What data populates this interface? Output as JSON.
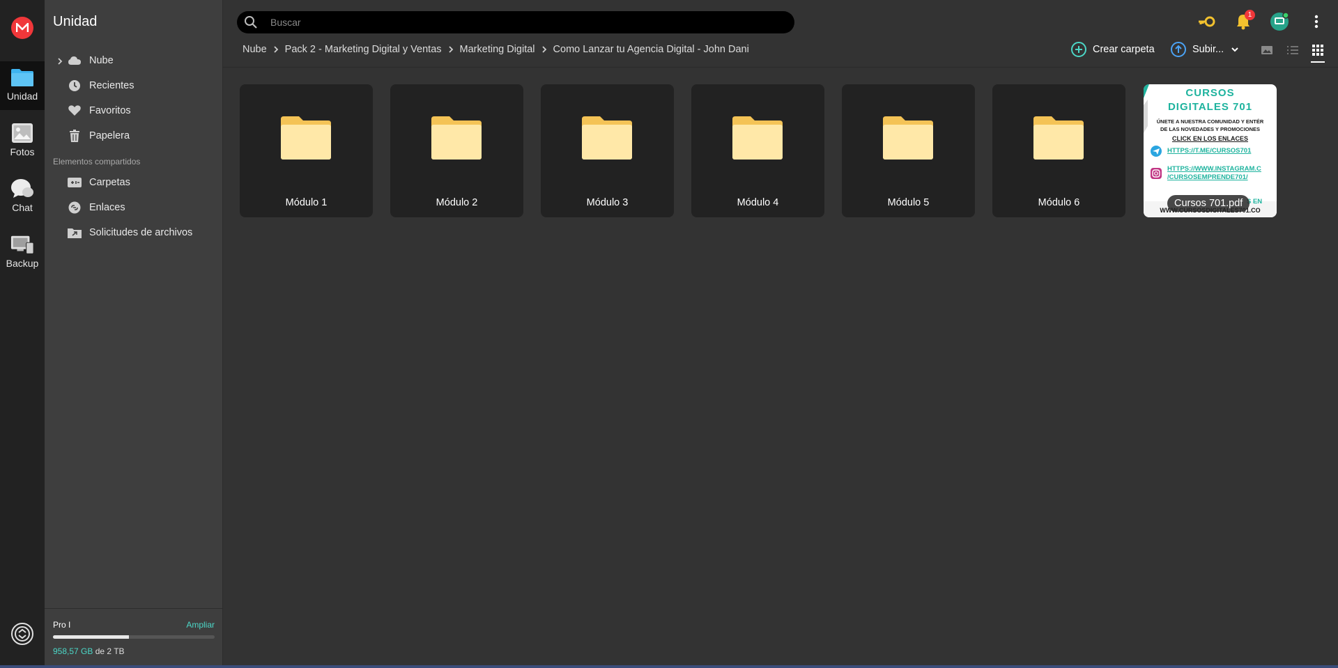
{
  "rail": {
    "items": [
      {
        "label": "Unidad",
        "icon": "folder-icon",
        "active": true
      },
      {
        "label": "Fotos",
        "icon": "photos-icon",
        "active": false
      },
      {
        "label": "Chat",
        "icon": "chat-icon",
        "active": false
      },
      {
        "label": "Backup",
        "icon": "backup-icon",
        "active": false
      }
    ],
    "colors": {
      "brand": "#f0373a",
      "folder_blue": "#3fb4f0"
    }
  },
  "sidebar": {
    "title": "Unidad",
    "items": [
      {
        "label": "Nube",
        "icon": "cloud-icon"
      },
      {
        "label": "Recientes",
        "icon": "clock-icon"
      },
      {
        "label": "Favoritos",
        "icon": "heart-icon"
      },
      {
        "label": "Papelera",
        "icon": "trash-icon"
      }
    ],
    "shared_section_label": "Elementos compartidos",
    "shared_items": [
      {
        "label": "Carpetas",
        "icon": "shared-folder-icon"
      },
      {
        "label": "Enlaces",
        "icon": "link-icon"
      },
      {
        "label": "Solicitudes de archivos",
        "icon": "file-request-icon"
      }
    ]
  },
  "storage": {
    "plan": "Pro I",
    "upgrade_label": "Ampliar",
    "used": "958,57 GB",
    "total_text": "de 2 TB",
    "used_fraction": 0.468
  },
  "search": {
    "placeholder": "Buscar",
    "value": ""
  },
  "topbar": {
    "notification_count": "1",
    "accent": "#4cd7c7"
  },
  "breadcrumb": [
    "Nube",
    "Pack 2 - Marketing Digital y Ventas",
    "Marketing Digital",
    "Como Lanzar tu Agencia Digital - John Dani"
  ],
  "actions": {
    "create_folder": "Crear carpeta",
    "upload": "Subir..."
  },
  "items": [
    {
      "name": "Módulo 1",
      "type": "folder"
    },
    {
      "name": "Módulo 2",
      "type": "folder"
    },
    {
      "name": "Módulo 3",
      "type": "folder"
    },
    {
      "name": "Módulo 4",
      "type": "folder"
    },
    {
      "name": "Módulo 5",
      "type": "folder"
    },
    {
      "name": "Módulo 6",
      "type": "folder"
    }
  ],
  "pdf": {
    "name": "Cursos 701.pdf",
    "thumb": {
      "title_line1": "CURSOS",
      "title_line2": "DIGITALES 701",
      "line1": "ÚNETE A NUESTRA COMUNIDAD Y ENTÉR",
      "line2": "DE LAS NOVEDADES Y PROMOCIONES",
      "cta": "CLICK EN LOS ENLACES",
      "link1": "HTTPS://T.ME/CURSOS701",
      "link2a": "HTTPS://WWW.INSTAGRAM.C",
      "link2b": "/CURSOSEMPRENDE701/",
      "footer1": "S EN",
      "footer2": "WWW.CURSOSDIGITALES701.CO"
    }
  }
}
